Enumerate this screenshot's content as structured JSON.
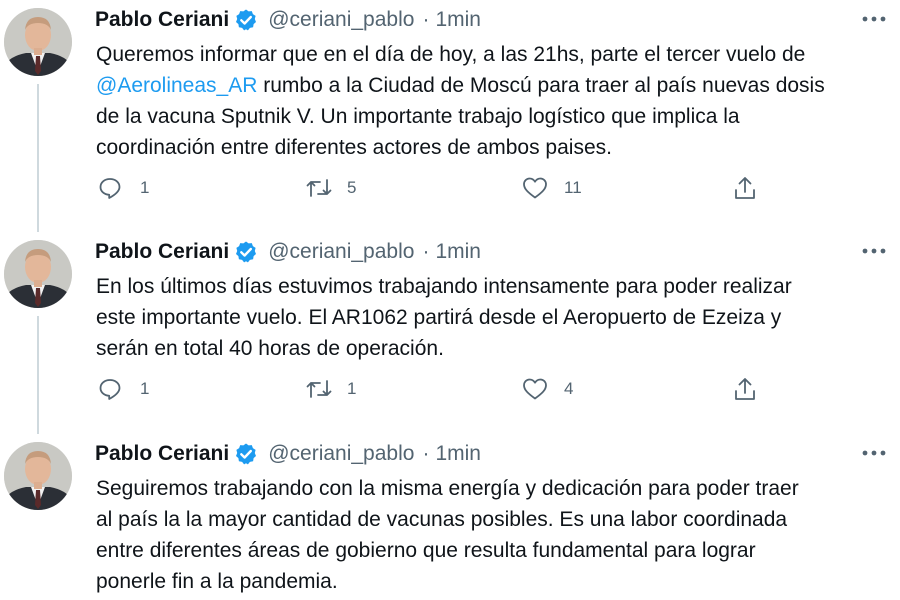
{
  "tweets": [
    {
      "author_name": "Pablo Ceriani",
      "handle": "@ceriani_pablo",
      "separator": "·",
      "time": "1min",
      "text_before": "Queremos informar que en el día de hoy, a las 21hs, parte el tercer vuelo de\n",
      "mention": "@Aerolineas_AR",
      "text_after": " rumbo a la Ciudad de Moscú para traer al país nuevas dosis\nde la vacuna Sputnik V. Un importante trabajo logístico que implica la\ncoordinación entre diferentes actores de ambos paises.",
      "replies": "1",
      "retweets": "5",
      "likes": "11"
    },
    {
      "author_name": "Pablo Ceriani",
      "handle": "@ceriani_pablo",
      "separator": "·",
      "time": "1min",
      "text": "En los últimos días estuvimos trabajando intensamente para poder realizar\neste importante vuelo. El AR1062 partirá desde el  Aeropuerto de Ezeiza y\nserán en total 40 horas de operación.",
      "replies": "1",
      "retweets": "1",
      "likes": "4"
    },
    {
      "author_name": "Pablo Ceriani",
      "handle": "@ceriani_pablo",
      "separator": "·",
      "time": "1min",
      "text": "Seguiremos trabajando con la misma energía y dedicación para poder traer\nal país la la mayor cantidad de vacunas posibles. Es una labor coordinada\nentre diferentes áreas de gobierno que resulta fundamental para lograr\nponerle fin a la pandemia."
    }
  ],
  "icons": {
    "reply": "reply-icon",
    "retweet": "retweet-icon",
    "like": "like-icon",
    "share": "share-icon",
    "more": "more-options-icon",
    "verified": "verified-badge-icon"
  },
  "colors": {
    "link": "#1d9bf0",
    "secondary_text": "#536471",
    "thread_line": "#cfd9de",
    "verified": "#1d9bf0"
  }
}
